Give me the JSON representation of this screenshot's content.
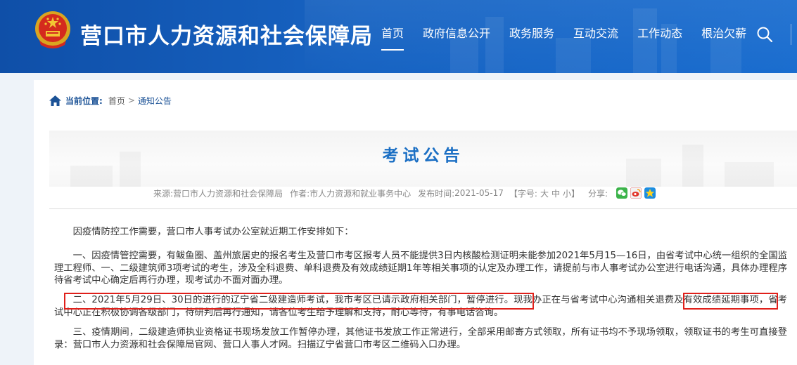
{
  "header": {
    "site_title": "营口市人力资源和社会保障局",
    "nav": [
      {
        "label": "首页",
        "active": true
      },
      {
        "label": "政府信息公开"
      },
      {
        "label": "政务服务"
      },
      {
        "label": "互动交流"
      },
      {
        "label": "工作动态"
      },
      {
        "label": "根治欠薪"
      }
    ]
  },
  "breadcrumb": {
    "label": "当前位置:",
    "home": "首页",
    "separator": ">",
    "current": "通知公告"
  },
  "article": {
    "title": "考试公告",
    "meta": {
      "source_label": "来源:",
      "source": "营口市人力资源和社会保障局",
      "author_label": "作者:",
      "author": "市人力资源和就业事务中心",
      "date_label": "发布时间:",
      "date": "2021-05-17",
      "font_label": "【字号:",
      "font_large": "大",
      "font_medium": "中",
      "font_small": "小",
      "font_close": "】",
      "share_label": "分享:"
    },
    "paragraphs": [
      "因疫情防控工作需要，营口市人事考试办公室就近期工作安排如下：",
      "一、因疫情管控需要，有鲅鱼圈、盖州旅居史的报名考生及营口市考区报考人员不能提供3日内核酸检测证明未能参加2021年5月15—16日，由省考试中心统一组织的全国监理工程师、一、二级建筑师3项考试的考生，涉及全科退费、单科退费及有效成绩延期1年等相关事项的认定及办理工作，请提前与市人事考试办公室进行电话沟通，具体办理程序待省考试中心确定后再行办理，现考试办不面对面办理。",
      "二、2021年5月29日、30日的进行的辽宁省二级建造师考试，我市考区已请示政府相关部门，暂停进行。现我办正在与省考试中心沟通相关退费及有效成绩延期事项，省考试中心正在积极协调各级部门，待研判后再行通知，请各位考生给予理解和支持，耐心等待，有事电话咨询。",
      "三、疫情期间，二级建造师执业资格证书现场发放工作暂停办理，其他证书发放工作正常进行，全部采用邮寄方式领取，所有证书均不予现场领取，领取证书的考生可直接登录：营口市人力资源和社会保障局官网、营口人事人才网。扫描辽宁省营口市考区二维码入口办理。"
    ]
  },
  "colors": {
    "header_blue": "#1763c2",
    "title_blue": "#1b6fc4",
    "highlight_red": "#e0201b"
  }
}
